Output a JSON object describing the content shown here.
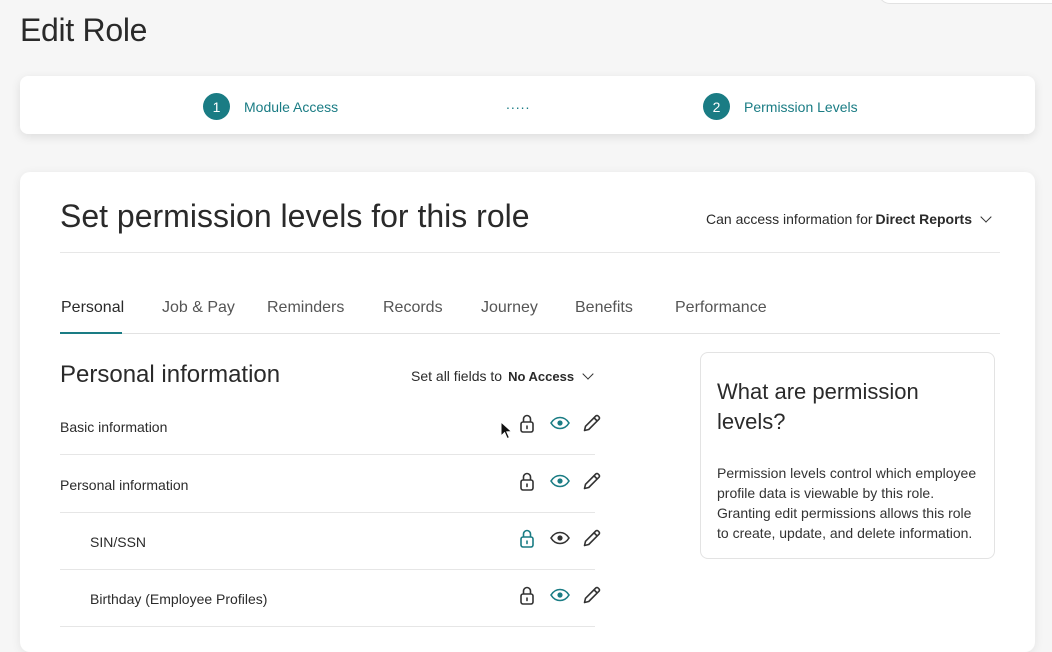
{
  "page": {
    "title": "Edit Role"
  },
  "stepper": {
    "steps": [
      {
        "number": "1",
        "label": "Module Access"
      },
      {
        "number": "2",
        "label": "Permission Levels"
      }
    ],
    "separator": "....."
  },
  "card": {
    "title": "Set permission levels for this role",
    "access": {
      "prefix": "Can access information for",
      "value": "Direct Reports"
    }
  },
  "tabs": [
    "Personal",
    "Job & Pay",
    "Reminders",
    "Records",
    "Journey",
    "Benefits",
    "Performance"
  ],
  "active_tab": "Personal",
  "section": {
    "title": "Personal information",
    "set_all_prefix": "Set all fields to",
    "set_all_value": "No Access",
    "rows": [
      {
        "label": "Basic information",
        "selected": "view"
      },
      {
        "label": "Personal information",
        "selected": "view"
      },
      {
        "label": "SIN/SSN",
        "selected": "no-access"
      },
      {
        "label": "Birthday (Employee Profiles)",
        "selected": "view"
      }
    ]
  },
  "info_box": {
    "title": "What are permission levels?",
    "text": "Permission levels control which employee profile data is viewable by this role. Granting edit permissions allows this role to create, update, and delete information."
  },
  "icons": {
    "no_access": "lock-icon",
    "view": "eye-icon",
    "edit": "pencil-icon"
  },
  "colors": {
    "accent": "#1a7c84",
    "text": "#2a2a2a",
    "icon_default": "#333333"
  }
}
